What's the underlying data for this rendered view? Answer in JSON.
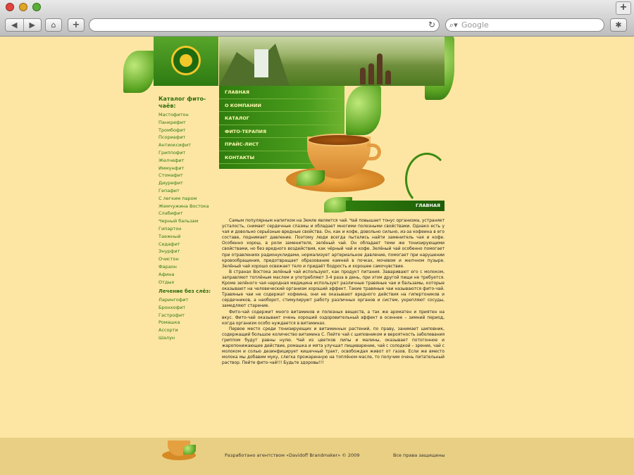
{
  "browser": {
    "search_placeholder": "Google",
    "add_tab": "+",
    "new_tab": "+"
  },
  "catalog": {
    "title": "Каталог фито-чаёв:",
    "items": [
      "Мастофитон",
      "Панкрефит",
      "Тромбофит",
      "Псориафит",
      "Антиоксифит",
      "Гриппофит",
      "Желчефит",
      "Иммунфит",
      "Стомафит",
      "Диурефит",
      "Гепафит",
      "С легким паром",
      "Жемчужина Востока",
      "Слабифит",
      "Черный бальзам",
      "Гипартон",
      "Таежный",
      "Седафит",
      "Энурфит",
      "Очистон",
      "Фараон",
      "Афина",
      "Отдых"
    ]
  },
  "treatment": {
    "title": "Лечение без слёз:",
    "items": [
      "Ларингофит",
      "Бронхофит",
      "Гастрофит",
      "Ромашка",
      "Ассорти",
      "Шалун"
    ]
  },
  "menu": [
    "ГЛАВНАЯ",
    "О КОМПАНИИ",
    "КАТАЛОГ",
    "ФИТО-ТЕРАПИЯ",
    "ПРАЙС-ЛИСТ",
    "КОНТАКТЫ"
  ],
  "page_title": "ГЛАВНАЯ",
  "article": {
    "p1": "Самым популярным напитком на Земле является чай. Чай повышает тонус организма, устраняет усталость, снимает сердечные спазмы и обладает многими полезными свойствами. Однако есть у чая и довольно серьёзные вредные свойства. Он, как и кофе, довольно сильно, из-за кофеина в его составе, поднимает давление. Поэтому люди всегда пытались найти заменитель чая и кофе. Особенно хорош, в роли заменителя, зелёный чай. Он обладает теми же тонизирующими свойствами, но без вредного воздействия, как чёрный чай и кофе. Зелёный чай особенно помогает при отравлениях радионуклидами, нормализует артериальное давление, помогает при нарушении кровообращения, предотвращает образование камней в почках, мочевом и желчном пузыре. Зелёный чай хорошо освежает тело и придаёт бодрость и хорошее самочувствие.",
    "p2": "В странах Востока зелёный чай используют, как продукт питания. Заваривают его с молоком, заправляют топлёным маслом и употребляют 3-4 раза в день, при этом другой пищи не требуется. Кроме зелёного чая народная медицина использует различные травяные чаи и бальзамы, которые оказывают на человеческий организм хороший эффект. Такие травяные чаи называются фито-чай. Травяные чаи не содержат кофеина, они не оказывают вредного действия на гипертоников и сердечников, а наоборот, стимулируют работу различных органов и систем, укрепляют сосуды, замедляют старение.",
    "p3": "Фито-чай содержит много витаминов и полезных веществ, а так же ароматен и приятен на вкус. Фито-чай оказывает очень хороший оздоровительный эффект в осеннее – зимний период, когда организм особо нуждается в витаминах.",
    "p4": "Первое место среди тонизирующих и витаминных растений, по праву, занимает шиповник, содержащий большое количество витамина С. Пейте чай с шиповником и вероятность заболевания гриппом будут равны нулю. Чай из цветков липы и малины, оказывает потогонное и жаропонижающее действие, ромашка и мята улучшат пищеварение, чай с солодкой – зрение, чай с молоком и солью дезинфицирует кишечный тракт, освобождая живот от газов. Если же вместо молока мы добавим муку, слегка прожаренную на топлёном масле, то получим очень питательный раствор. Пейте фито-чай!!! Будьте здоровы!!!"
  },
  "footer": {
    "credit": "Разработано агентством «Davidoff Brandmaker» © 2009",
    "rights": "Все права защищены"
  },
  "colors": {
    "background": "#fde6a3",
    "accent_green": "#2f7d0e",
    "menu_text": "#fff7b0"
  }
}
